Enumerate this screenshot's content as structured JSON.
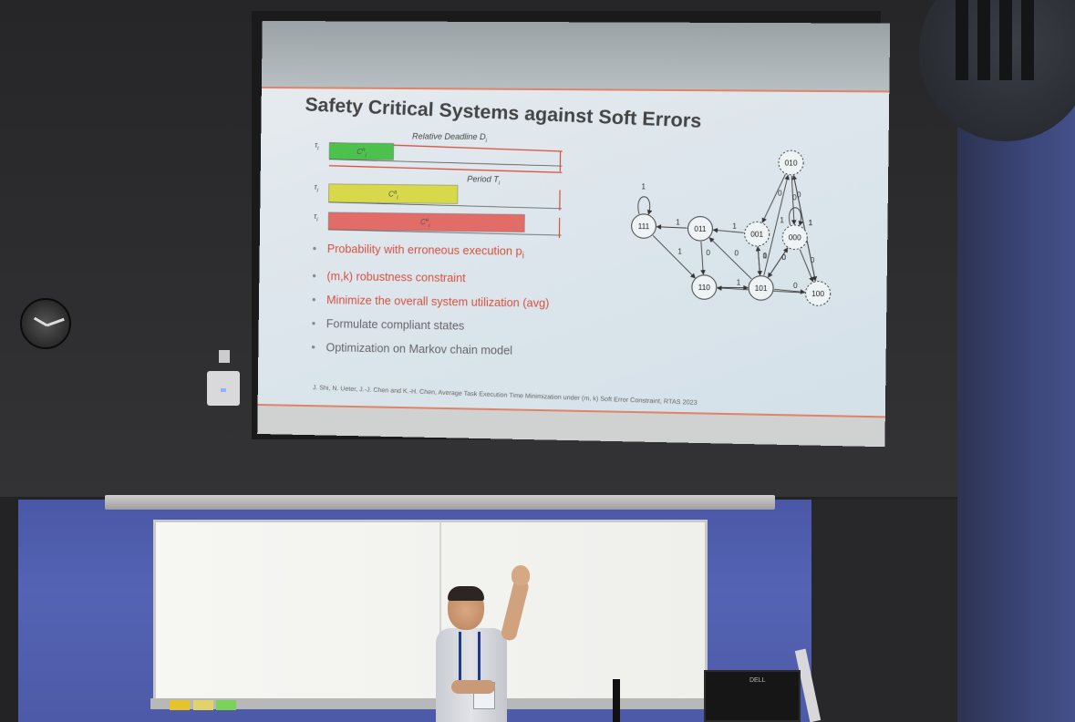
{
  "slide": {
    "title": "Safety Critical Systems against Soft Errors",
    "timing": {
      "deadline_label": "Relative Deadline D",
      "deadline_sub": "i",
      "period_label": "Period T",
      "period_sub": "i",
      "task_label": "τ",
      "task_sub": "i",
      "bars": [
        {
          "label": "C",
          "sup": "n",
          "sub": "i",
          "color": "#4cc24c",
          "fill": 0.28
        },
        {
          "label": "C",
          "sup": "a",
          "sub": "i",
          "color": "#d7d84a",
          "fill": 0.56
        },
        {
          "label": "C",
          "sup": "e",
          "sub": "i",
          "color": "#e26c68",
          "fill": 0.85
        }
      ]
    },
    "bullets": [
      {
        "text": "Probability with erroneous execution p",
        "sub": "i",
        "style": "red"
      },
      {
        "text": "(m,k) robustness constraint",
        "sub": "",
        "style": "red"
      },
      {
        "text": "Minimize the overall system utilization (avg)",
        "sub": "",
        "style": "red"
      },
      {
        "text": "Formulate compliant states",
        "sub": "",
        "style": "grey"
      },
      {
        "text": "Optimization on Markov chain model",
        "sub": "",
        "style": "grey"
      }
    ],
    "reference": "J. Shi, N. Ueter, J.-J. Chen and K.-H. Chen, Average Task Execution Time Minimization under (m, k) Soft Error Constraint, RTAS 2023",
    "markov": {
      "states": [
        "111",
        "011",
        "001",
        "000",
        "010",
        "110",
        "101",
        "100"
      ],
      "edge_labels": [
        "1",
        "1",
        "1",
        "0",
        "0",
        "1",
        "0",
        "1",
        "0",
        "0",
        "1",
        "0",
        "1",
        "0",
        "0",
        "1",
        "0",
        "0",
        "1",
        "0"
      ]
    }
  },
  "room": {
    "monitor_brand": "DELL"
  }
}
